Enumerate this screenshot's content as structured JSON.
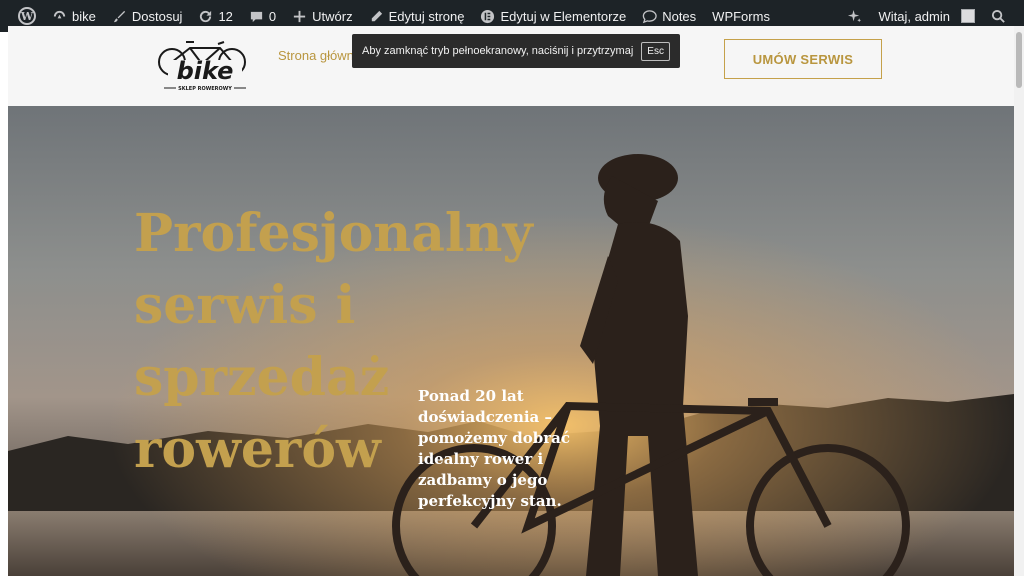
{
  "admin_bar": {
    "site_name": "bike",
    "customize": "Dostosuj",
    "updates_count": "12",
    "comments_count": "0",
    "new": "Utwórz",
    "edit_page": "Edytuj stronę",
    "edit_elementor": "Edytuj w Elementorze",
    "notes": "Notes",
    "wpforms": "WPForms",
    "greeting": "Witaj, admin"
  },
  "header": {
    "logo_text": "bike",
    "logo_tagline": "SKLEP ROWEROWY",
    "nav_home": "Strona główn",
    "cta_label": "UMÓW SERWIS"
  },
  "fullscreen_toast": {
    "message": "Aby zamknąć tryb pełnoekranowy, naciśnij i przytrzymaj",
    "key": "Esc"
  },
  "hero": {
    "title": "Profesjonalny serwis i sprzedaż rowerów",
    "subtitle": "Ponad 20 lat doświadczenia – pomożemy dobrać idealny rower i zadbamy o jego perfekcyjny stan."
  },
  "colors": {
    "accent_gold": "#c3a04e",
    "admin_bar": "#1d2327"
  }
}
